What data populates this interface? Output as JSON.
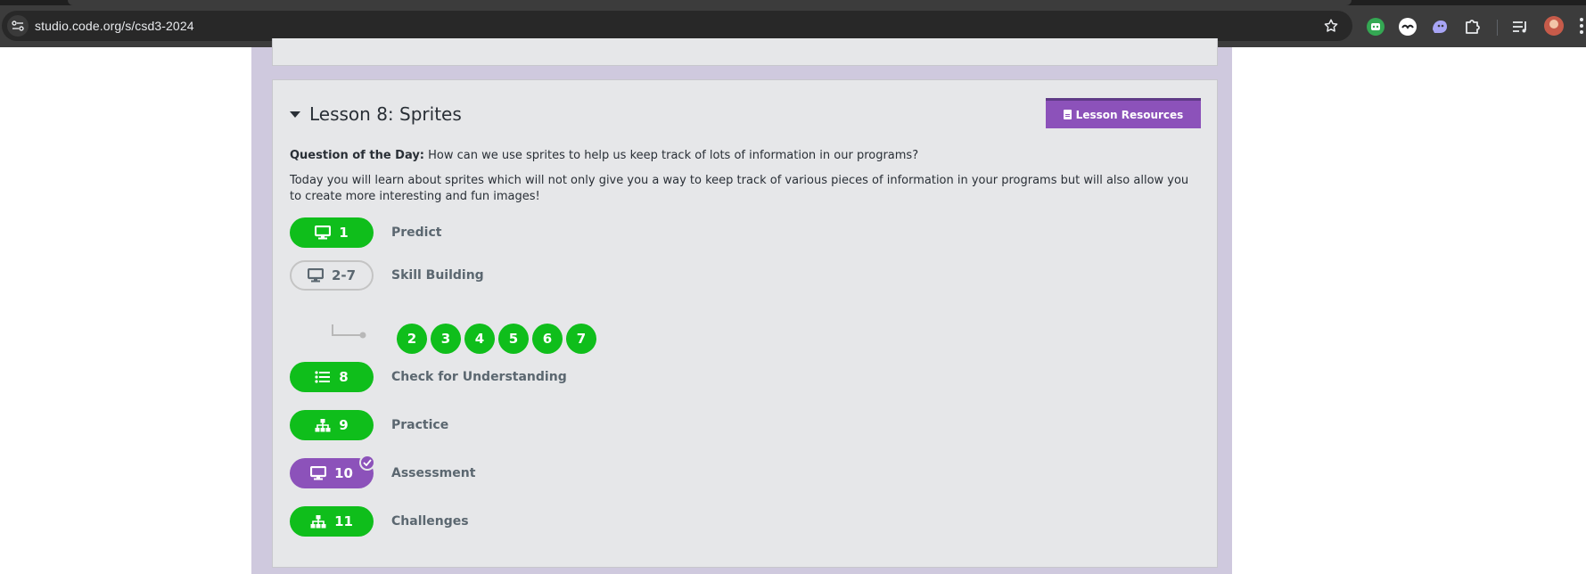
{
  "browser": {
    "url": "studio.code.org/s/csd3-2024",
    "icons": [
      "site-info-icon",
      "bookmark-star-icon",
      "extension-robot-icon",
      "extension-mask-icon",
      "extension-ghost-icon",
      "extensions-puzzle-icon",
      "media-queue-icon",
      "profile-avatar",
      "browser-menu-icon"
    ]
  },
  "lesson": {
    "title": "Lesson 8: Sprites",
    "resources_label": "Lesson Resources",
    "qod_label": "Question of the Day:",
    "qod_text": " How can we use sprites to help us keep track of lots of information in our programs?",
    "description": "Today you will learn about sprites which will not only give you a way to keep track of various pieces of information in your programs but will also allow you to create more interesting and fun images!"
  },
  "levels": [
    {
      "number": "1",
      "label": "Predict",
      "icon": "computer-icon",
      "style": "complete"
    },
    {
      "number": "2-7",
      "label": "Skill Building",
      "icon": "computer-icon",
      "style": "outline"
    },
    {
      "number": "8",
      "label": "Check for Understanding",
      "icon": "list-icon",
      "style": "complete"
    },
    {
      "number": "9",
      "label": "Practice",
      "icon": "hierarchy-icon",
      "style": "complete"
    },
    {
      "number": "10",
      "label": "Assessment",
      "icon": "computer-icon",
      "style": "assessment-complete"
    },
    {
      "number": "11",
      "label": "Challenges",
      "icon": "hierarchy-icon",
      "style": "complete"
    }
  ],
  "sublevels": [
    "2",
    "3",
    "4",
    "5",
    "6",
    "7"
  ],
  "colors": {
    "complete_green": "#0fbe1b",
    "brand_purple": "#8c52ba",
    "column_lavender": "#cfc9de",
    "card_gray": "#e6e7e9"
  }
}
